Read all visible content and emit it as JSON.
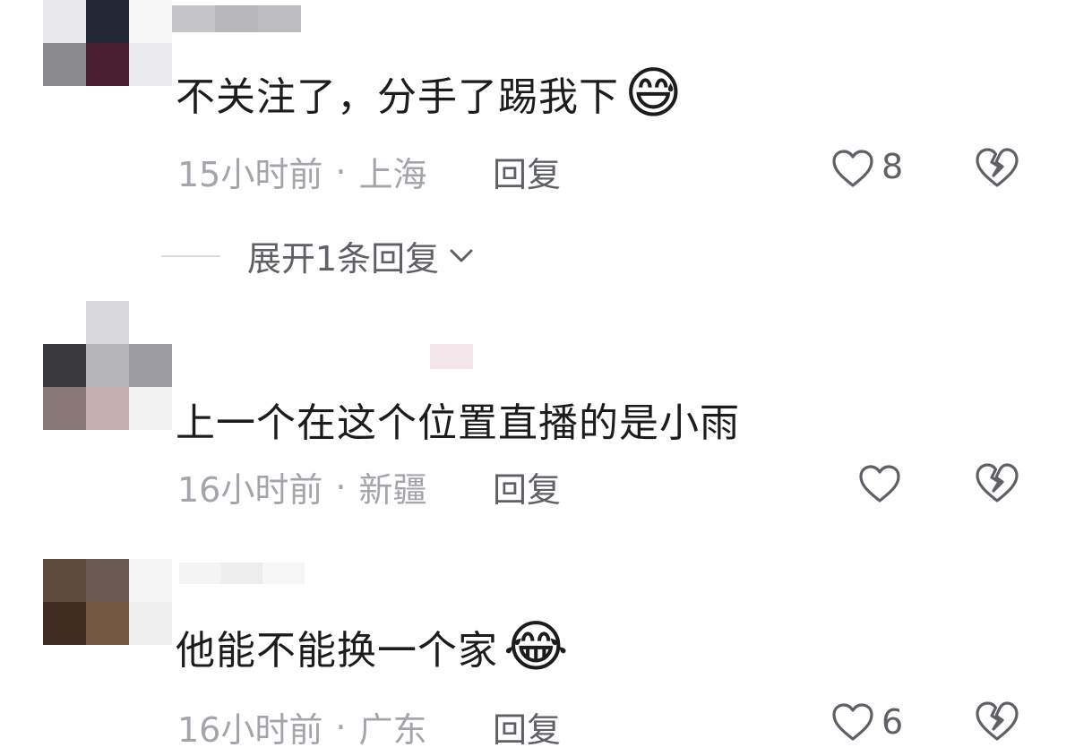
{
  "comments": [
    {
      "text": "不关注了，分手了踢我下",
      "emoji": "😅",
      "time": "15小时前",
      "location": "上海",
      "reply_label": "回复",
      "likes": "8"
    },
    {
      "text": "上一个在这个位置直播的是小雨",
      "emoji": "",
      "time": "16小时前",
      "location": "新疆",
      "reply_label": "回复",
      "likes": ""
    },
    {
      "text": "他能不能换一个家",
      "emoji": "😂",
      "time": "16小时前",
      "location": "广东",
      "reply_label": "回复",
      "likes": "6"
    }
  ],
  "expand_replies": {
    "label": "展开1条回复"
  },
  "separator": "·",
  "icons": {
    "like": "heart-outline-icon",
    "dislike": "broken-heart-icon",
    "expand": "chevron-down-icon"
  },
  "colors": {
    "text": "#1c1c1e",
    "meta": "#a4a4aa",
    "action": "#5f5f66"
  }
}
